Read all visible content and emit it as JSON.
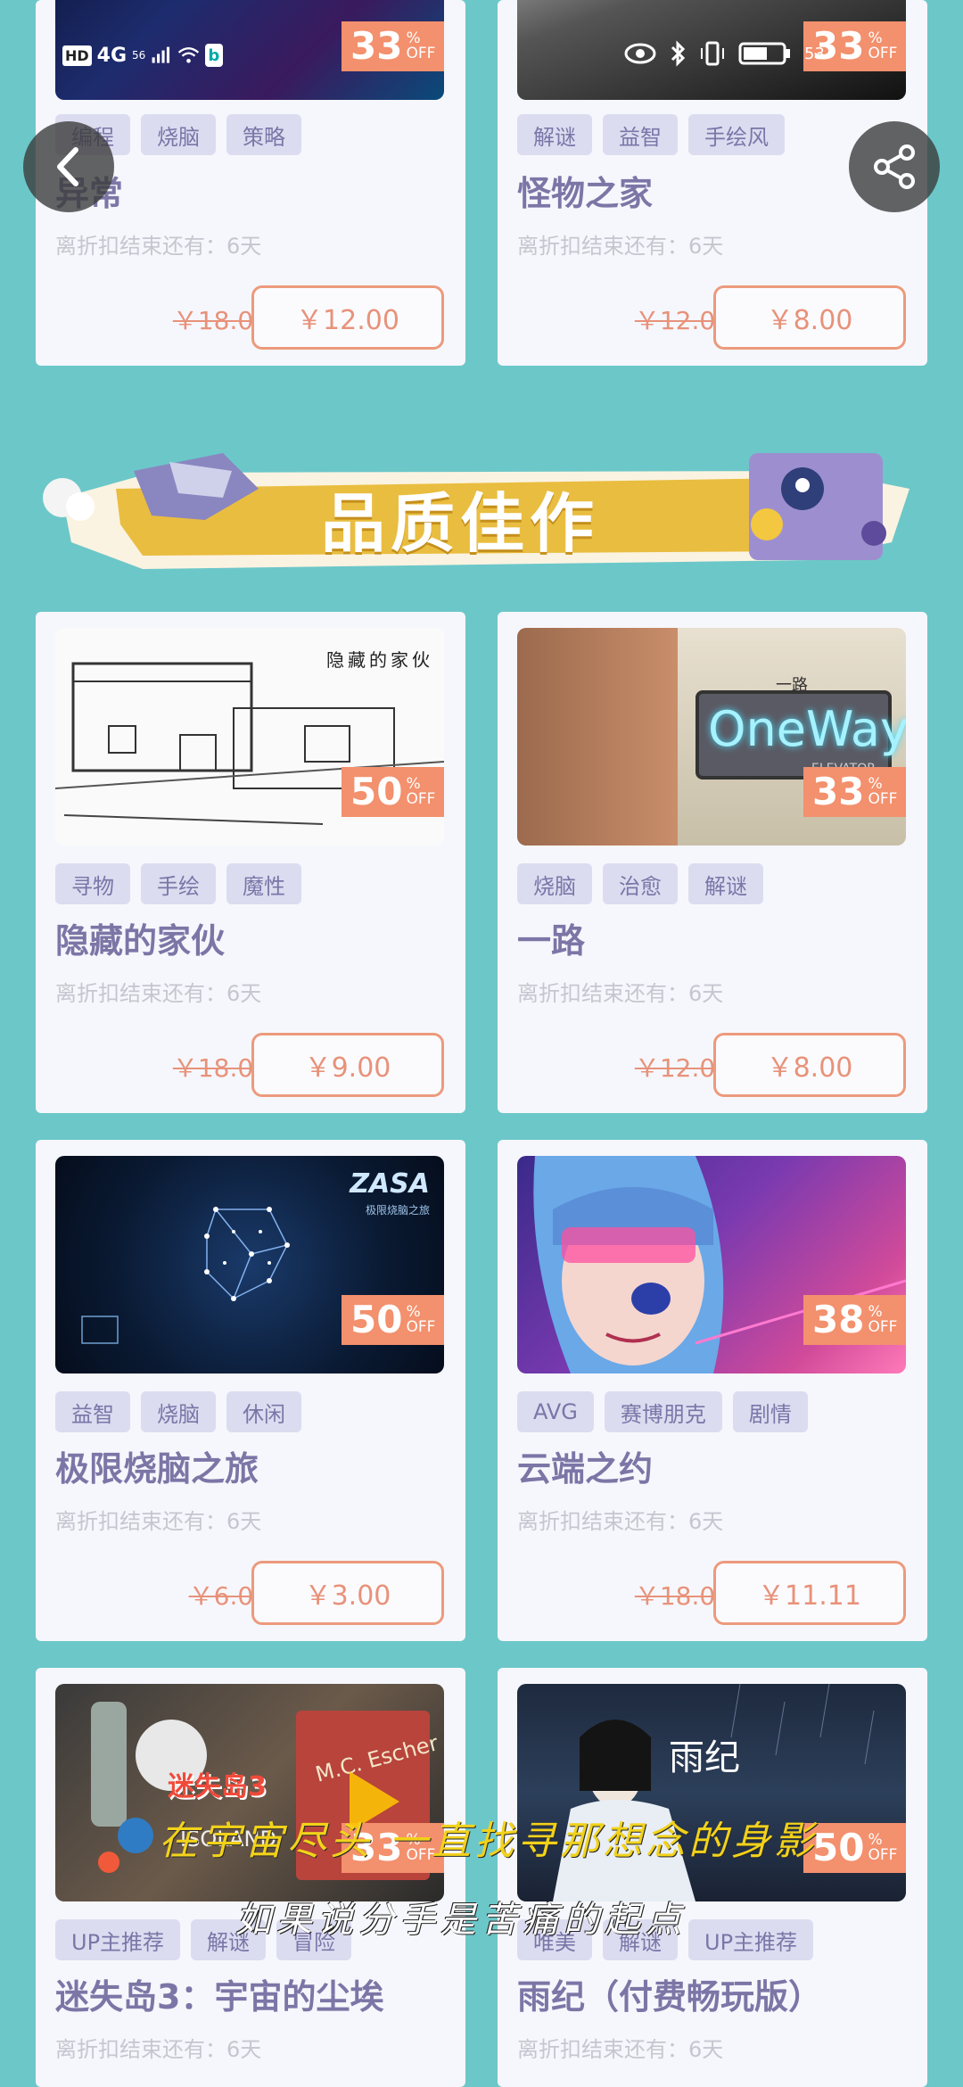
{
  "status_bar": {
    "network": "4G",
    "net_sub": "56",
    "battery": "53"
  },
  "section": {
    "title": "品质佳作"
  },
  "cards": [
    {
      "discount": "33",
      "pct": "%",
      "off": "OFF",
      "tags": [
        "编程",
        "烧脑",
        "策略"
      ],
      "title": "异常",
      "timer": "离折扣结束还有：6天",
      "old_price": "￥18.00",
      "new_price": "￥12.00"
    },
    {
      "discount": "33",
      "pct": "%",
      "off": "OFF",
      "tags": [
        "解谜",
        "益智",
        "手绘风"
      ],
      "title": "怪物之家",
      "timer": "离折扣结束还有：6天",
      "old_price": "￥12.00",
      "new_price": "￥8.00"
    },
    {
      "discount": "50",
      "pct": "%",
      "off": "OFF",
      "tags": [
        "寻物",
        "手绘",
        "魔性"
      ],
      "title": "隐藏的家伙",
      "timer": "离折扣结束还有：6天",
      "old_price": "￥18.00",
      "new_price": "￥9.00",
      "art_text": "隐藏的家伙"
    },
    {
      "discount": "33",
      "pct": "%",
      "off": "OFF",
      "tags": [
        "烧脑",
        "治愈",
        "解谜"
      ],
      "title": "一路",
      "timer": "离折扣结束还有：6天",
      "old_price": "￥12.00",
      "new_price": "￥8.00",
      "art_text": "OneWay",
      "art_sub": "ELEVATOR",
      "art_cn": "一路"
    },
    {
      "discount": "50",
      "pct": "%",
      "off": "OFF",
      "tags": [
        "益智",
        "烧脑",
        "休闲"
      ],
      "title": "极限烧脑之旅",
      "timer": "离折扣结束还有：6天",
      "old_price": "￥6.00",
      "new_price": "￥3.00",
      "art_text": "ZASA",
      "art_sub": "极限烧脑之旅"
    },
    {
      "discount": "38",
      "pct": "%",
      "off": "OFF",
      "tags": [
        "AVG",
        "赛博朋克",
        "剧情"
      ],
      "title": "云端之约",
      "timer": "离折扣结束还有：6天",
      "old_price": "￥18.00",
      "new_price": "￥11.11"
    },
    {
      "discount": "33",
      "pct": "%",
      "off": "OFF",
      "tags": [
        "UP主推荐",
        "解谜",
        "冒险"
      ],
      "title": "迷失岛3：宇宙的尘埃",
      "timer": "离折扣结束还有：6天",
      "art_text": "迷失岛3",
      "art_sub": "ISOLAND",
      "art_extra": "M.C. Escher"
    },
    {
      "discount": "50",
      "pct": "%",
      "off": "OFF",
      "tags": [
        "唯美",
        "解谜",
        "UP主推荐"
      ],
      "title": "雨纪（付费畅玩版）",
      "timer": "离折扣结束还有：6天",
      "art_text": "雨纪"
    }
  ],
  "overlay": {
    "line1": "在宇宙尽头 一直找寻那想念的身影",
    "line2": "如果说分手是苦痛的起点"
  },
  "colors": {
    "background": "#6cc7c9",
    "accent": "#f3906d",
    "tag_bg": "#dcdcf0",
    "title": "#7b76a6"
  }
}
